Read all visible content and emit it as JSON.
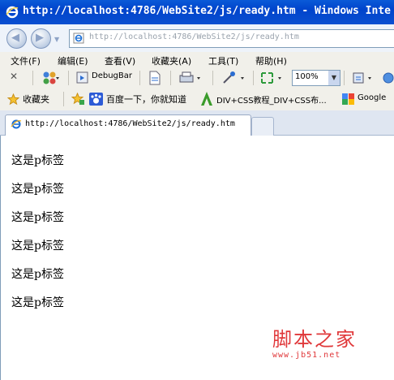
{
  "window": {
    "title": "http://localhost:4786/WebSite2/js/ready.htm - Windows Inte"
  },
  "address": {
    "url": "http://localhost:4786/WebSite2/js/ready.htm"
  },
  "menu": [
    "文件(F)",
    "编辑(E)",
    "查看(V)",
    "收藏夹(A)",
    "工具(T)",
    "帮助(H)"
  ],
  "command_bar": {
    "debugbar_label": "DebugBar",
    "zoom": "100%"
  },
  "favorites": {
    "label": "收藏夹",
    "items": [
      "百度一下，你就知道",
      "DIV+CSS教程_DIV+CSS布...",
      "Google"
    ]
  },
  "tab": {
    "title": "http://localhost:4786/WebSite2/js/ready.htm"
  },
  "content": {
    "paragraphs": [
      "这是p标签",
      "这是p标签",
      "这是p标签",
      "这是p标签",
      "这是p标签",
      "这是p标签"
    ]
  },
  "watermark": {
    "line1": "脚本之家",
    "line2": "www.jb51.net"
  },
  "colors": {
    "titlebar": "#0044cc",
    "watermark": "#e0383a"
  }
}
